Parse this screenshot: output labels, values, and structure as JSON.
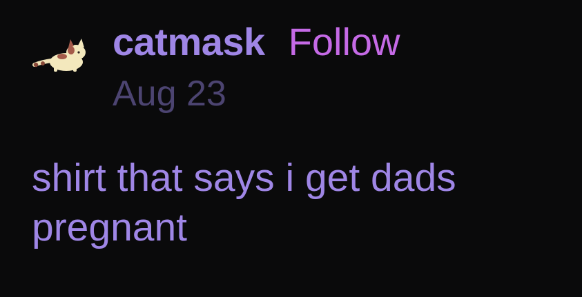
{
  "post": {
    "username": "catmask",
    "follow_label": "Follow",
    "date": "Aug 23",
    "body": "shirt that says i get dads pregnant",
    "avatar_icon": "cat-avatar-icon"
  },
  "colors": {
    "background": "#0a0a0b",
    "username": "#9f86e6",
    "follow": "#c56ae6",
    "date": "#4c4471",
    "body_text": "#9f86e6"
  }
}
